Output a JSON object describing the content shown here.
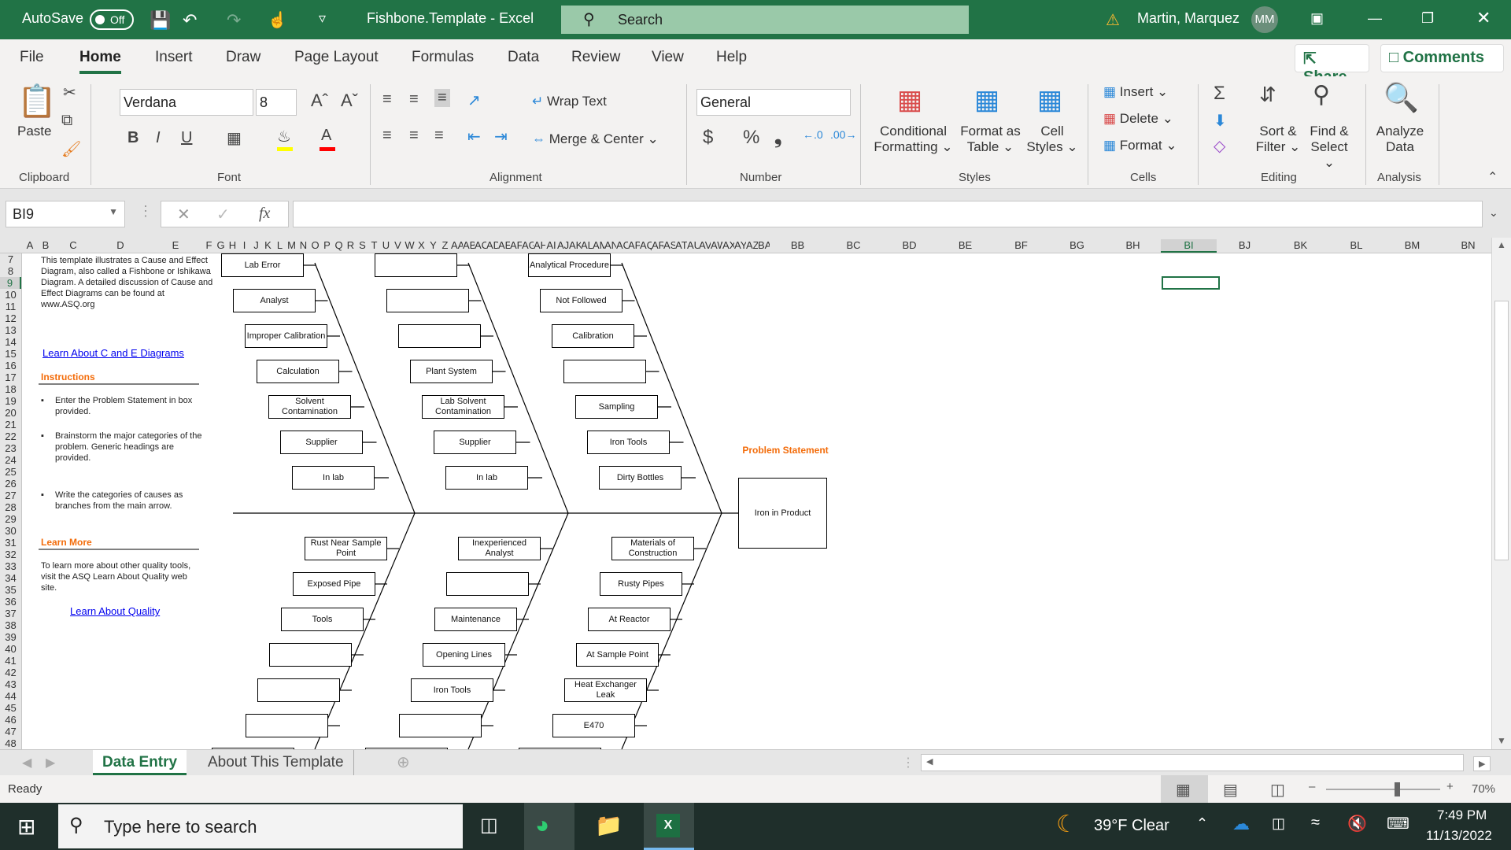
{
  "titlebar": {
    "autosave_label": "AutoSave",
    "autosave_state": "Off",
    "doc_title": "Fishbone.Template - Excel",
    "search_placeholder": "Search",
    "user_name": "Martin, Marquez",
    "user_initials": "MM"
  },
  "menu_tabs": [
    "File",
    "Home",
    "Insert",
    "Draw",
    "Page Layout",
    "Formulas",
    "Data",
    "Review",
    "View",
    "Help"
  ],
  "active_tab": "Home",
  "share_label": "Share",
  "comments_label": "Comments",
  "ribbon": {
    "clipboard": {
      "paste": "Paste",
      "label": "Clipboard"
    },
    "font": {
      "name": "Verdana",
      "size": "8",
      "label": "Font",
      "bold": "B",
      "italic": "I",
      "underline": "U",
      "fill_color": "#ffff00",
      "font_color": "#ff0000"
    },
    "alignment": {
      "wrap_text": "Wrap Text",
      "merge_center": "Merge & Center",
      "label": "Alignment"
    },
    "number": {
      "format": "General",
      "currency": "$",
      "percent": "%",
      "comma": "9",
      "label": "Number"
    },
    "styles": {
      "conditional": [
        "Conditional",
        "Formatting"
      ],
      "format_table": [
        "Format as",
        "Table"
      ],
      "cell_styles": [
        "Cell",
        "Styles"
      ],
      "label": "Styles"
    },
    "cells": {
      "insert": "Insert",
      "delete": "Delete",
      "format": "Format",
      "label": "Cells"
    },
    "editing": {
      "sort": [
        "Sort &",
        "Filter"
      ],
      "find": [
        "Find &",
        "Select"
      ],
      "label": "Editing"
    },
    "analysis": {
      "analyze": [
        "Analyze",
        "Data"
      ],
      "label": "Analysis"
    }
  },
  "formula_bar": {
    "name_box": "BI9",
    "formula": ""
  },
  "columns": [
    "A",
    "B",
    "C",
    "D",
    "E",
    "F",
    "G",
    "H",
    "I",
    "J",
    "K",
    "L",
    "M",
    "N",
    "O",
    "P",
    "Q",
    "R",
    "S",
    "T",
    "U",
    "V",
    "W",
    "X",
    "Y",
    "Z",
    "AA",
    "AB",
    "AC",
    "AD",
    "AE",
    "AF",
    "AG",
    "AH",
    "AI",
    "AJ",
    "AK",
    "AL",
    "AM",
    "AN",
    "AO",
    "AP",
    "AQ",
    "AR",
    "AS",
    "AT",
    "AU",
    "AV",
    "AW",
    "AX",
    "AY",
    "AZ",
    "BA",
    "BB",
    "BC",
    "BD",
    "BE",
    "BF",
    "BG",
    "BH",
    "BI",
    "BJ",
    "BK",
    "BL",
    "BM",
    "BN"
  ],
  "selected_column": "BI",
  "rows": [
    7,
    8,
    9,
    10,
    11,
    12,
    13,
    14,
    15,
    16,
    17,
    18,
    19,
    20,
    21,
    22,
    23,
    24,
    25,
    26,
    27,
    28,
    29,
    30,
    31,
    32,
    33,
    34,
    35,
    36,
    37,
    38,
    39,
    40,
    41,
    42,
    43,
    44,
    45,
    46,
    47,
    48
  ],
  "selected_row": 9,
  "sidebar": {
    "intro": "This template illustrates a Cause and Effect Diagram, also called a Fishbone or Ishikawa Diagram.  A detailed discussion of Cause and Effect Diagrams can be found at www.ASQ.org",
    "link1": "Learn About C and E Diagrams",
    "instructions_heading": "Instructions",
    "instructions": [
      "Enter the Problem Statement in box provided.",
      "Brainstorm the major categories of the problem.  Generic headings are provided.",
      "Write the categories of causes as branches from the main arrow."
    ],
    "learn_more_heading": "Learn More",
    "learn_more_text": "To learn more about other quality tools, visit the ASQ Learn About Quality web site.",
    "link2": "Learn About Quality"
  },
  "fishbone": {
    "problem_label": "Problem Statement",
    "problem": "Iron in Product",
    "top_bones": [
      [
        "Lab Error",
        "Analyst",
        "Improper Calibration",
        "Calculation",
        "Solvent Contamination",
        "Supplier",
        "In lab"
      ],
      [
        "",
        "",
        "",
        "Plant System",
        "Lab Solvent Contamination",
        "Supplier",
        "In lab"
      ],
      [
        "Analytical Procedure",
        "Not Followed",
        "Calibration",
        "",
        "Sampling",
        "Iron Tools",
        "Dirty Bottles"
      ]
    ],
    "bottom_bones": [
      [
        "Rust Near Sample Point",
        "Exposed Pipe",
        "Tools",
        "",
        "",
        ""
      ],
      [
        "Inexperienced Analyst",
        "",
        "Maintenance",
        "Opening Lines",
        "Iron Tools",
        ""
      ],
      [
        "Materials of Construction",
        "Rusty Pipes",
        "At Reactor",
        "At Sample Point",
        "Heat Exchanger Leak",
        "E470"
      ]
    ]
  },
  "sheet_tabs": [
    "Data Entry",
    "About This Template"
  ],
  "active_sheet": "Data Entry",
  "status": {
    "ready": "Ready",
    "zoom": "70%",
    "zoom_fraction": 0.7
  },
  "taskbar": {
    "search_placeholder": "Type here to search",
    "weather": "39°F  Clear",
    "time": "7:49 PM",
    "date": "11/13/2022"
  }
}
